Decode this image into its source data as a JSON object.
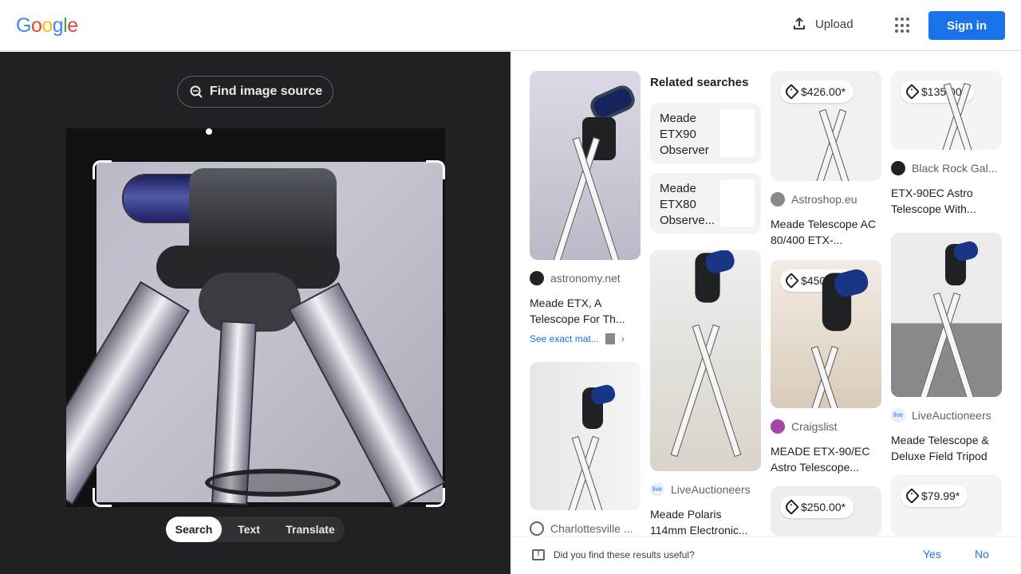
{
  "header": {
    "logo": [
      "G",
      "o",
      "o",
      "g",
      "l",
      "e"
    ],
    "upload_label": "Upload",
    "signin_label": "Sign in"
  },
  "left": {
    "find_source_label": "Find image source",
    "modes": [
      "Search",
      "Text",
      "Translate"
    ]
  },
  "results": [
    {
      "source": "astronomy.net",
      "title": "Meade ETX, A Telescope For Th...",
      "exact": "See exact mat..."
    },
    {
      "source": "Charlottesville ...",
      "title": ""
    },
    {
      "source": "LiveAuctioneers",
      "title": "Meade Polaris 114mm Electronic..."
    },
    {
      "source": "Astroshop.eu",
      "title": "Meade Telescope AC 80/400 ETX-...",
      "price": "$426.00*"
    },
    {
      "source": "Craigslist",
      "title": "MEADE ETX-90/EC Astro Telescope...",
      "price": "$450.00*"
    },
    {
      "price": "$250.00*"
    },
    {
      "source": "Black Rock Gal...",
      "title": "ETX-90EC Astro Telescope With...",
      "price": "$135.00*"
    },
    {
      "source": "LiveAuctioneers",
      "title": "Meade Telescope & Deluxe Field Tripod"
    },
    {
      "price": "$79.99*"
    }
  ],
  "related": {
    "title": "Related searches",
    "items": [
      "Meade ETX90 Observer",
      "Meade ETX80 Observe..."
    ]
  },
  "feedback": {
    "question": "Did you find these results useful?",
    "yes": "Yes",
    "no": "No"
  },
  "colors": {
    "primary": "#1a73e8",
    "left_background": "#202124",
    "telescope_blue": "#1d2164"
  }
}
